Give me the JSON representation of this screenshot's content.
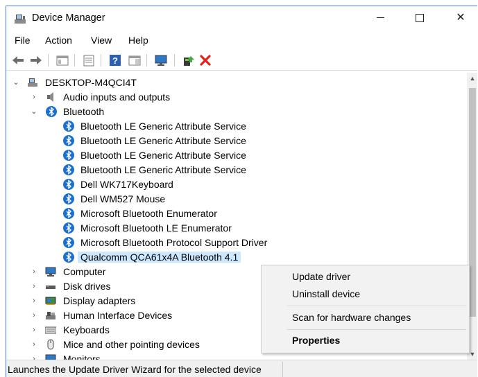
{
  "window": {
    "title": "Device Manager",
    "minimize_icon": "minimize-icon",
    "maximize_icon": "maximize-icon",
    "close_icon": "close-icon"
  },
  "menu": [
    "File",
    "Action",
    "View",
    "Help"
  ],
  "toolbar": [
    "back-arrow-icon",
    "forward-arrow-icon",
    "properties-sheet-icon",
    "show-hidden-icon",
    "help-icon",
    "action-pane-icon",
    "computer-monitor-icon",
    "update-driver-icon",
    "uninstall-x-icon"
  ],
  "tree": {
    "root": "DESKTOP-M4QCI4T",
    "categories_top": [
      {
        "label": "Audio inputs and outputs",
        "expanded": false,
        "icon": "speaker-icon"
      },
      {
        "label": "Bluetooth",
        "expanded": true,
        "icon": "bluetooth-icon"
      }
    ],
    "bluetooth_children": [
      "Bluetooth LE Generic Attribute Service",
      "Bluetooth LE Generic Attribute Service",
      "Bluetooth LE Generic Attribute Service",
      "Bluetooth LE Generic Attribute Service",
      "Dell WK717Keyboard",
      "Dell WM527 Mouse",
      "Microsoft Bluetooth Enumerator",
      "Microsoft Bluetooth LE Enumerator",
      "Microsoft Bluetooth Protocol Support Driver",
      "Qualcomm QCA61x4A Bluetooth 4.1"
    ],
    "selected_device": "Qualcomm QCA61x4A Bluetooth 4.1",
    "categories_bottom": [
      {
        "label": "Computer",
        "icon": "computer-icon"
      },
      {
        "label": "Disk drives",
        "icon": "disk-drive-icon"
      },
      {
        "label": "Display adapters",
        "icon": "display-adapter-icon"
      },
      {
        "label": "Human Interface Devices",
        "icon": "hid-icon"
      },
      {
        "label": "Keyboards",
        "icon": "keyboard-icon"
      },
      {
        "label": "Mice and other pointing devices",
        "icon": "mouse-icon"
      },
      {
        "label": "Monitors",
        "icon": "monitor-icon"
      }
    ]
  },
  "context_menu": {
    "update_driver": "Update driver",
    "uninstall_device": "Uninstall device",
    "scan_hardware": "Scan for hardware changes",
    "properties": "Properties"
  },
  "status_bar": "Launches the Update Driver Wizard for the selected device",
  "colors": {
    "selection": "#cce8ff",
    "bluetooth": "#1a6fd0",
    "uninstall_red": "#e0201b",
    "window_border": "#4a7bd0"
  }
}
